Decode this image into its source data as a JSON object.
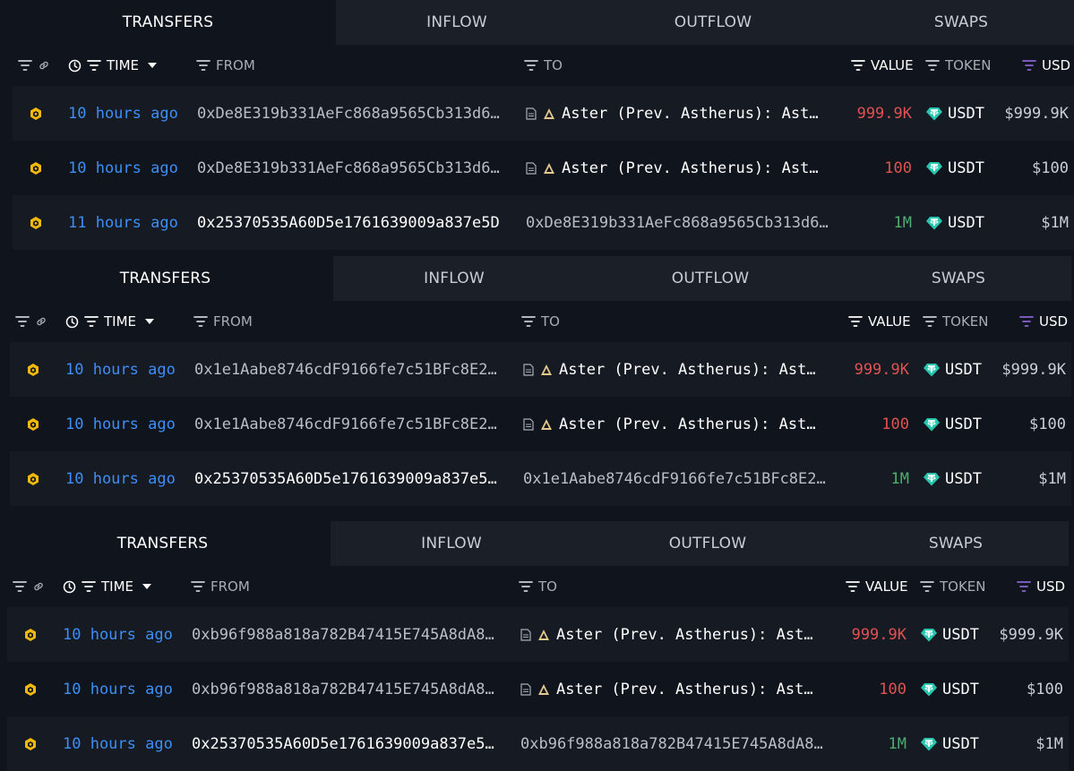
{
  "colors": {
    "accent_blue": "#3d8ef5",
    "value_red": "#e05252",
    "value_green": "#4caf6f",
    "token_teal": "#26c6b0",
    "usd_purple": "#8a63d2",
    "chip_yellow": "#f0b90b"
  },
  "tabs": [
    "TRANSFERS",
    "INFLOW",
    "OUTFLOW",
    "SWAPS"
  ],
  "headers": {
    "time": "TIME",
    "from": "FROM",
    "to": "TO",
    "value": "VALUE",
    "token": "TOKEN",
    "usd": "USD"
  },
  "panels": [
    {
      "rows": [
        {
          "time": "10 hours ago",
          "from": "0xDe8E319b331AeFc868a9565Cb313d6…",
          "to": "Aster (Prev. Astherus): Ast…",
          "value": "999.9K",
          "token": "USDT",
          "usd": "$999.9K"
        },
        {
          "time": "10 hours ago",
          "from": "0xDe8E319b331AeFc868a9565Cb313d6…",
          "to": "Aster (Prev. Astherus): Ast…",
          "value": "100",
          "token": "USDT",
          "usd": "$100"
        },
        {
          "time": "11 hours ago",
          "from": "0x25370535A60D5e1761639009a837e5D",
          "to": "0xDe8E319b331AeFc868a9565Cb313d6…",
          "value": "1M",
          "token": "USDT",
          "usd": "$1M"
        }
      ]
    },
    {
      "rows": [
        {
          "time": "10 hours ago",
          "from": "0x1e1Aabe8746cdF9166fe7c51BFc8E2…",
          "to": "Aster (Prev. Astherus): Ast…",
          "value": "999.9K",
          "token": "USDT",
          "usd": "$999.9K"
        },
        {
          "time": "10 hours ago",
          "from": "0x1e1Aabe8746cdF9166fe7c51BFc8E2…",
          "to": "Aster (Prev. Astherus): Ast…",
          "value": "100",
          "token": "USDT",
          "usd": "$100"
        },
        {
          "time": "10 hours ago",
          "from": "0x25370535A60D5e1761639009a837e5…",
          "to": "0x1e1Aabe8746cdF9166fe7c51BFc8E2…",
          "value": "1M",
          "token": "USDT",
          "usd": "$1M"
        }
      ]
    },
    {
      "rows": [
        {
          "time": "10 hours ago",
          "from": "0xb96f988a818a782B47415E745A8dA8…",
          "to": "Aster (Prev. Astherus): Ast…",
          "value": "999.9K",
          "token": "USDT",
          "usd": "$999.9K"
        },
        {
          "time": "10 hours ago",
          "from": "0xb96f988a818a782B47415E745A8dA8…",
          "to": "Aster (Prev. Astherus): Ast…",
          "value": "100",
          "token": "USDT",
          "usd": "$100"
        },
        {
          "time": "10 hours ago",
          "from": "0x25370535A60D5e1761639009a837e5…",
          "to": "0xb96f988a818a782B47415E745A8dA8…",
          "value": "1M",
          "token": "USDT",
          "usd": "$1M"
        }
      ]
    }
  ]
}
